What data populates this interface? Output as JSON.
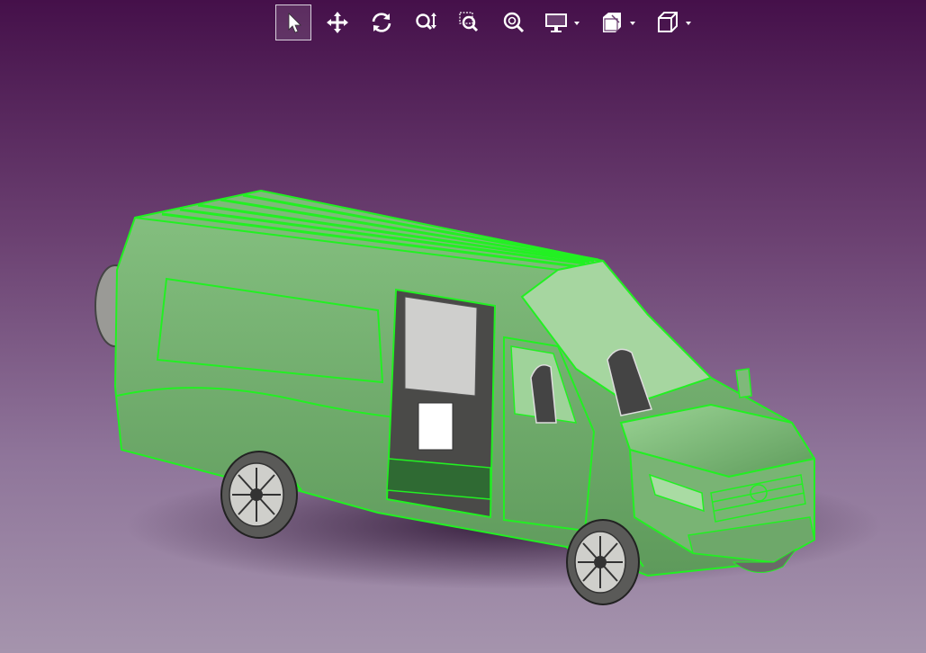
{
  "toolbar": {
    "tools": [
      {
        "id": "select",
        "icon": "cursor-arrow-icon",
        "active": true
      },
      {
        "id": "pan",
        "icon": "move-arrows-icon",
        "active": false
      },
      {
        "id": "rotate",
        "icon": "rotate-icon",
        "active": false
      },
      {
        "id": "zoom-in-out",
        "icon": "zoom-updown-icon",
        "active": false
      },
      {
        "id": "zoom-area",
        "icon": "zoom-area-icon",
        "active": false
      },
      {
        "id": "zoom-fit",
        "icon": "zoom-fit-icon",
        "active": false
      },
      {
        "id": "display-mode",
        "icon": "monitor-icon",
        "dropdown": true
      },
      {
        "id": "section-view",
        "icon": "section-cut-icon",
        "dropdown": true
      },
      {
        "id": "view-orientation",
        "icon": "cube-view-icon",
        "dropdown": true
      }
    ]
  },
  "colors": {
    "background_top": "#45104a",
    "background_bottom": "#a594ad",
    "highlight_edge": "#22f022",
    "body_fill": "#6fb06b",
    "tool_icon": "#ffffff"
  },
  "model": {
    "subject": "van-3d-model",
    "selected": true
  }
}
